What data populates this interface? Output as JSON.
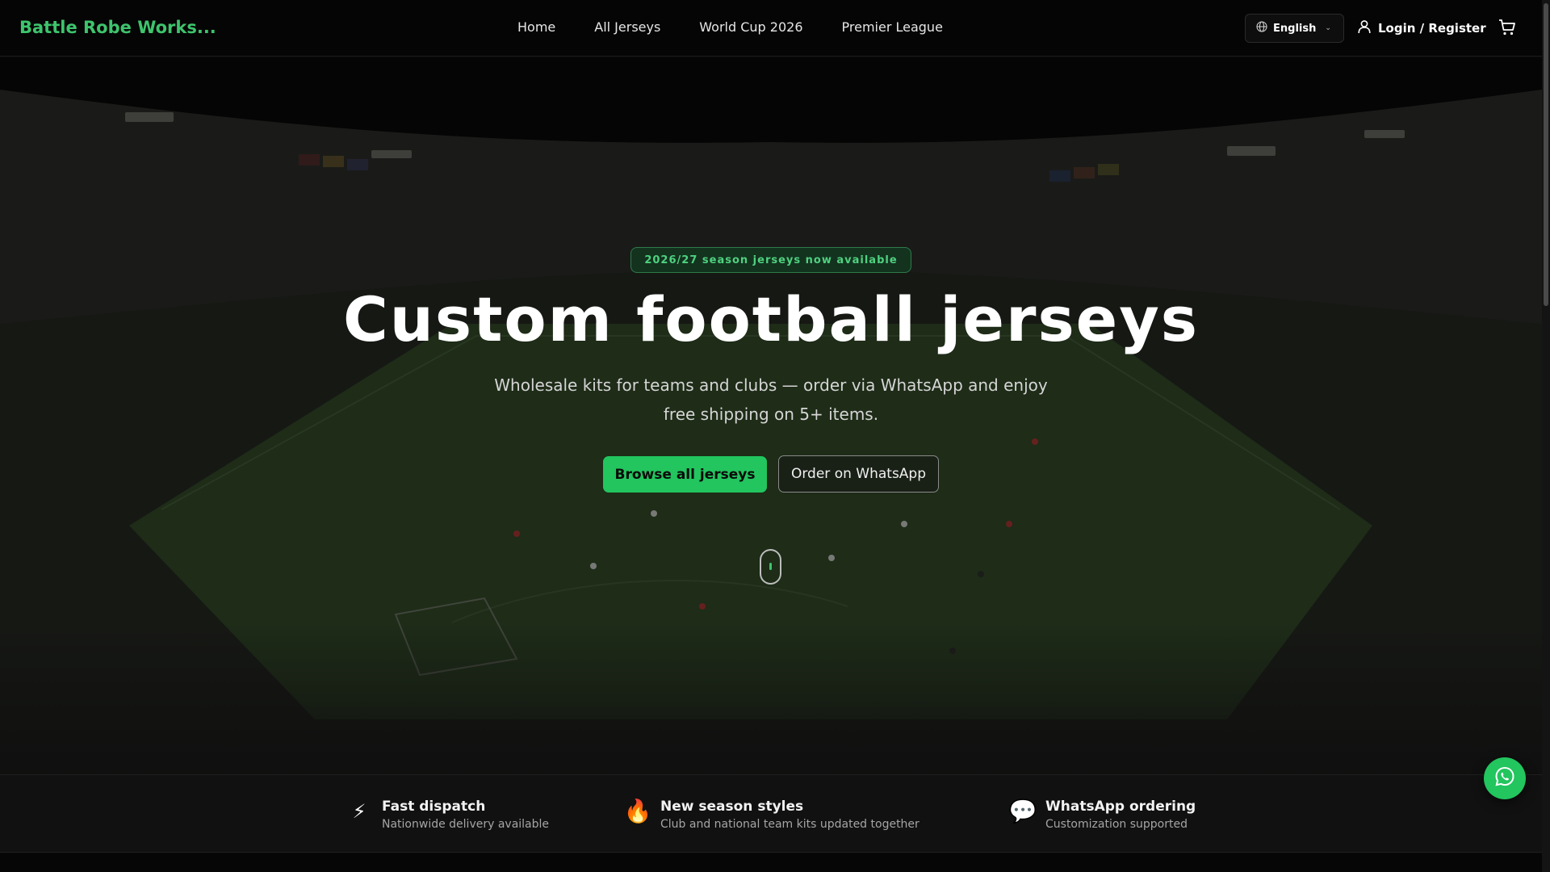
{
  "brand": {
    "name": "Battle Robe Works..."
  },
  "nav": {
    "items": [
      {
        "label": "Home"
      },
      {
        "label": "All Jerseys"
      },
      {
        "label": "World Cup 2026"
      },
      {
        "label": "Premier League"
      }
    ]
  },
  "header": {
    "language": "English",
    "login_label": "Login / Register",
    "icons": {
      "language": "globe-icon",
      "user": "user-icon",
      "cart": "cart-icon"
    }
  },
  "hero": {
    "badge": "2026/27 season jerseys now available",
    "title": "Custom football jerseys",
    "subtitle": "Wholesale kits for teams and clubs — order via WhatsApp and enjoy free shipping on 5+ items.",
    "primary_button": "Browse all jerseys",
    "secondary_button": "Order on WhatsApp",
    "background": "stadium-photo"
  },
  "features": [
    {
      "icon": "lightning-icon",
      "glyph": "⚡",
      "title": "Fast dispatch",
      "desc": "Nationwide delivery available"
    },
    {
      "icon": "fire-icon",
      "glyph": "🔥",
      "title": "New season styles",
      "desc": "Club and national team kits updated together"
    },
    {
      "icon": "speech-bubble-icon",
      "glyph": "💬",
      "title": "WhatsApp ordering",
      "desc": "Customization supported"
    }
  ],
  "colors": {
    "accent": "#22c55e",
    "brand": "#3ec46d",
    "header_bg": "#050505",
    "features_bg": "#111111"
  }
}
